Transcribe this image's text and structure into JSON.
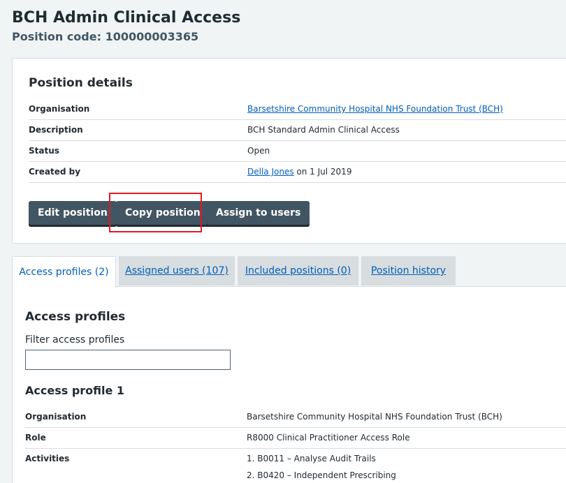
{
  "header": {
    "title": "BCH Admin Clinical Access",
    "subtitle": "Position code: 100000003365"
  },
  "details": {
    "heading": "Position details",
    "rows": [
      {
        "key": "Organisation",
        "value": "Barsetshire Community Hospital NHS Foundation Trust (BCH)"
      },
      {
        "key": "Description",
        "value": "BCH Standard Admin Clinical Access"
      },
      {
        "key": "Status",
        "value": "Open"
      },
      {
        "key": "Created by",
        "link": "Della Jones",
        "value": " on 1 Jul 2019"
      }
    ],
    "buttons": {
      "edit": "Edit position",
      "copy": "Copy position",
      "assign": "Assign to users"
    }
  },
  "tabs": [
    {
      "label": "Access profiles (2)",
      "active": true
    },
    {
      "label": "Assigned users (107)",
      "active": false
    },
    {
      "label": "Included positions (0)",
      "active": false
    },
    {
      "label": "Position history",
      "active": false
    }
  ],
  "access_profiles": {
    "heading": "Access profiles",
    "filter_label": "Filter access profiles",
    "filter_value": "",
    "profile_1": {
      "heading": "Access profile 1",
      "rows": [
        {
          "key": "Organisation",
          "value": "Barsetshire Community Hospital NHS Foundation Trust (BCH)"
        },
        {
          "key": "Role",
          "value": "R8000 Clinical Practitioner Access Role"
        },
        {
          "key": "Activities",
          "items": [
            "1. B0011 – Analyse Audit Trails",
            "2. B0420 – Independent Prescribing"
          ]
        }
      ]
    }
  },
  "colors": {
    "primary_button": "#425563",
    "link": "#005eb8",
    "highlight": "#e01a22",
    "page_bg": "#f0f4f5"
  }
}
